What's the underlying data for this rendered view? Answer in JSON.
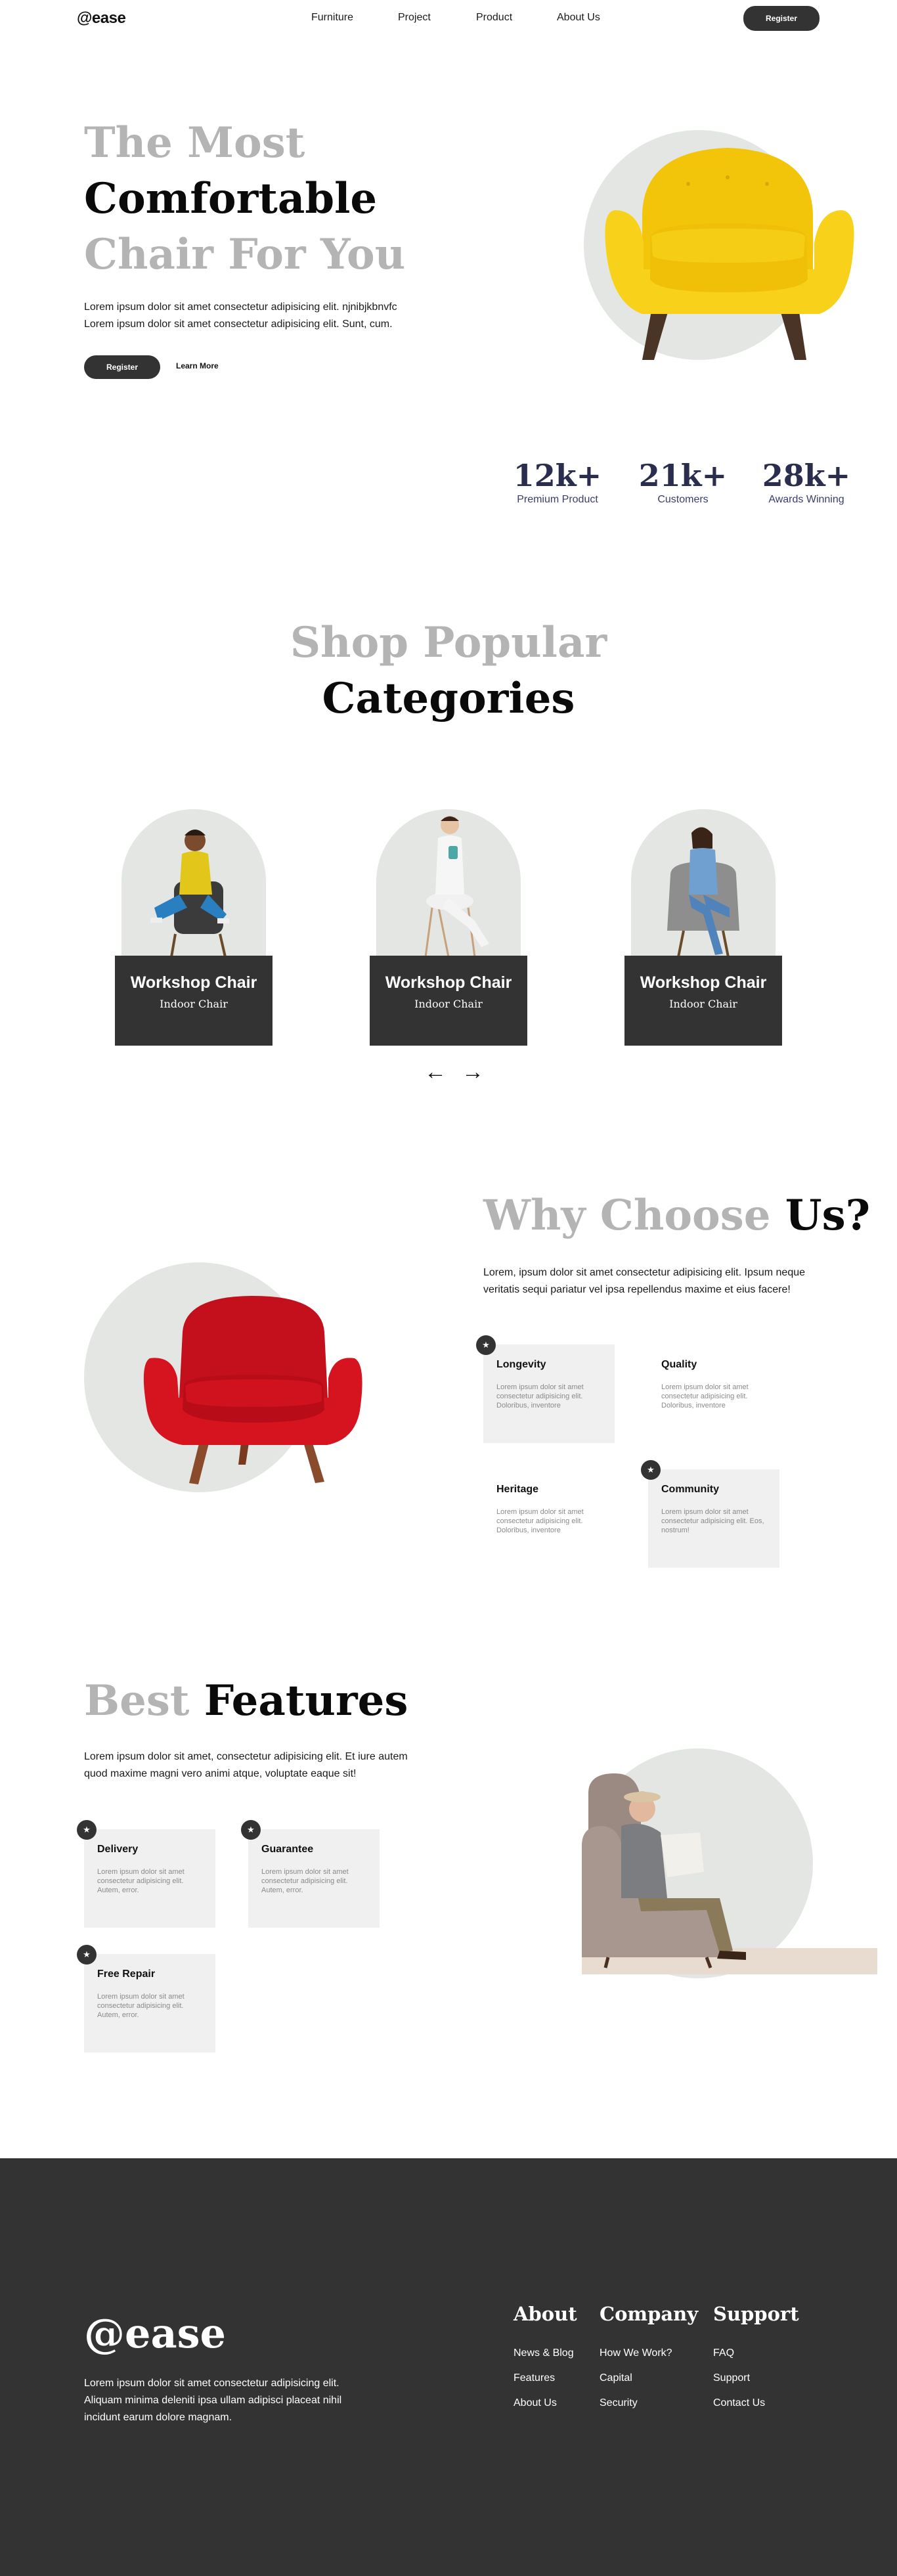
{
  "nav": {
    "logo": "@ease",
    "links": [
      "Furniture",
      "Project",
      "Product",
      "About Us"
    ],
    "register_label": "Register"
  },
  "hero": {
    "title_line1": "The Most",
    "title_line2": "Comfortable",
    "title_line3": "Chair For You",
    "desc_line1": "Lorem ipsum dolor sit amet consectetur adipisicing elit. njnibjkbnvfc",
    "desc_line2": "Lorem ipsum dolor sit amet consectetur adipisicing elit. Sunt, cum.",
    "register_label": "Register",
    "learn_label": "Learn More"
  },
  "stats": [
    {
      "value": "12k+",
      "label": "Premium Product"
    },
    {
      "value": "21k+",
      "label": "Customers"
    },
    {
      "value": "28k+",
      "label": "Awards Winning"
    }
  ],
  "shop": {
    "title_grey": "Shop Popular",
    "title_black": "Categories",
    "cards": [
      {
        "name": "Workshop Chair",
        "sub": "Indoor Chair"
      },
      {
        "name": "Workshop Chair",
        "sub": "Indoor Chair"
      },
      {
        "name": "Workshop Chair",
        "sub": "Indoor Chair"
      }
    ],
    "prev_arrow": "←",
    "next_arrow": "→"
  },
  "why": {
    "title_grey": "Why Choose",
    "title_black": "Us?",
    "desc": "Lorem, ipsum dolor sit amet consectetur adipisicing elit. Ipsum neque veritatis sequi pariatur vel ipsa repellendus maxime et eius facere!",
    "features": [
      {
        "title": "Longevity",
        "text": "Lorem ipsum dolor sit amet consectetur adipisicing elit. Doloribus, inventore"
      },
      {
        "title": "Quality",
        "text": "Lorem ipsum dolor sit amet consectetur adipisicing elit. Doloribus, inventore"
      },
      {
        "title": "Heritage",
        "text": "Lorem ipsum dolor sit amet consectetur adipisicing elit. Doloribus, inventore"
      },
      {
        "title": "Community",
        "text": "Lorem ipsum dolor sit amet consectetur adipisicing elit. Eos, nostrum!"
      }
    ]
  },
  "best": {
    "title_grey": "Best",
    "title_black": "Features",
    "desc": "Lorem ipsum dolor sit amet, consectetur adipisicing elit. Et iure autem quod maxime magni vero animi atque, voluptate eaque sit!",
    "features": [
      {
        "title": "Delivery",
        "text": "Lorem ipsum dolor sit amet consectetur adipisicing elit. Autem, error."
      },
      {
        "title": "Guarantee",
        "text": "Lorem ipsum dolor sit amet consectetur adipisicing elit. Autem, error."
      },
      {
        "title": "Free Repair",
        "text": "Lorem ipsum dolor sit amet consectetur adipisicing elit. Autem, error."
      }
    ]
  },
  "footer": {
    "logo": "@ease",
    "desc": "Lorem ipsum dolor sit amet consectetur adipisicing elit. Aliquam minima deleniti ipsa ullam adipisci placeat nihil incidunt earum dolore magnam.",
    "columns": [
      {
        "head": "About",
        "links": [
          "News & Blog",
          "Features",
          "About Us"
        ]
      },
      {
        "head": "Company",
        "links": [
          "How We Work?",
          "Capital",
          "Security"
        ]
      },
      {
        "head": "Support",
        "links": [
          "FAQ",
          "Support",
          "Contact Us"
        ]
      }
    ]
  },
  "icons": {
    "badge": "star-icon"
  },
  "colors": {
    "dark": "#333333",
    "grey_title": "#b4b4b4",
    "circle_bg": "#e3e6e3",
    "stat_navy": "#2b2d4f",
    "card_bg": "#eff0ef",
    "yellow_chair": "#f5cc0c",
    "red_chair": "#d3121d"
  }
}
